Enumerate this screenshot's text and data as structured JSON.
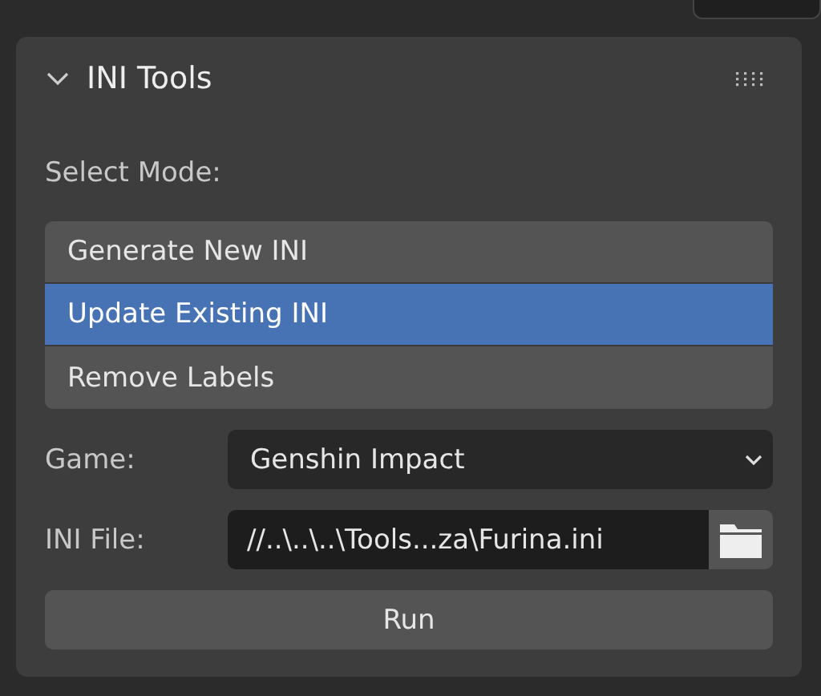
{
  "panel": {
    "title": "INI Tools",
    "expanded": true
  },
  "mode_label": "Select Mode:",
  "modes": [
    {
      "label": "Generate New INI",
      "selected": false
    },
    {
      "label": "Update Existing INI",
      "selected": true
    },
    {
      "label": "Remove Labels",
      "selected": false
    }
  ],
  "game": {
    "label": "Game:",
    "value": "Genshin Impact"
  },
  "ini_file": {
    "label": "INI File:",
    "value": "//..\\..\\..\\Tools...za\\Furina.ini"
  },
  "run_button": "Run"
}
